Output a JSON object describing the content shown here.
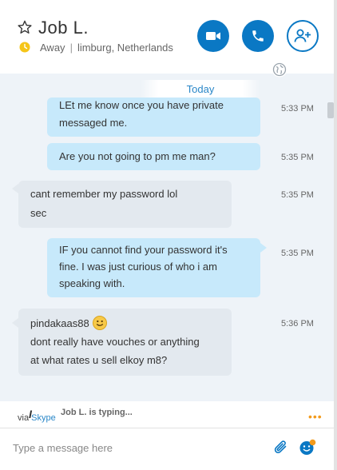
{
  "header": {
    "contact_name": "Job L.",
    "presence_status": "Away",
    "location": "limburg, Netherlands",
    "icons": {
      "favorite": "star-outline-icon",
      "presence": "away-clock-icon",
      "video": "video-camera-icon",
      "call": "phone-icon",
      "add_people": "add-person-icon",
      "globe": "globe-icon"
    },
    "accent_color": "#0a78c4",
    "away_color": "#f5c518"
  },
  "conversation": {
    "date_divider": "Today",
    "messages": [
      {
        "direction": "outgoing",
        "lines": [
          "LEt me know once you have private",
          "messaged me."
        ],
        "time": "5:33 PM"
      },
      {
        "direction": "outgoing",
        "lines": [
          "Are you not going to pm me man?"
        ],
        "time": "5:35 PM"
      },
      {
        "direction": "incoming",
        "lines": [
          "cant remember my password lol",
          "sec"
        ],
        "time": "5:35 PM"
      },
      {
        "direction": "outgoing",
        "lines": [
          "IF you cannot find your password it's",
          "fine. I was just curious of who i am",
          "speaking with."
        ],
        "time": "5:35 PM"
      },
      {
        "direction": "incoming",
        "lines": [
          "pindakaas88",
          "dont really have vouches or anything",
          "at what rates u sell elkoy m8?"
        ],
        "time": "5:36 PM",
        "emoji": "smile-emoticon-icon"
      }
    ],
    "colors": {
      "outgoing_bubble": "#c7e9fb",
      "incoming_bubble": "#e3e9ef",
      "background": "#eef3f8"
    }
  },
  "status": {
    "typing_icon": "I",
    "typing_text": "Job L. is typing...",
    "via_prefix": "via",
    "via_link": "Skype",
    "more_icon": "more-options-dots-icon"
  },
  "composer": {
    "placeholder": "Type a message here",
    "value": "",
    "attach_icon": "paperclip-icon",
    "emoticon_icon": "emoticon-picker-icon"
  }
}
